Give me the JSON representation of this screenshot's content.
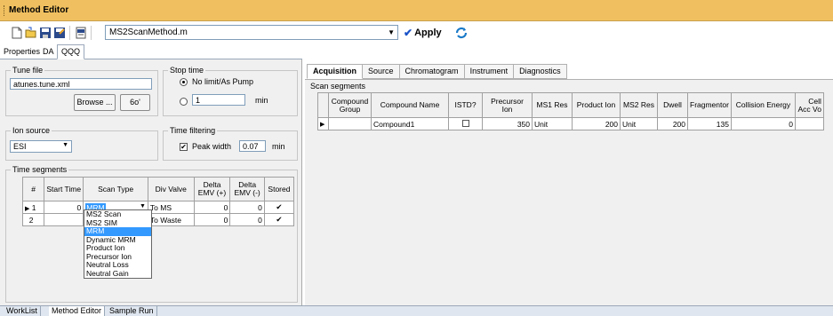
{
  "window": {
    "title": "Method Editor"
  },
  "toolbar": {
    "method_file": "MS2ScanMethod.m",
    "apply_label": "Apply",
    "icons": [
      "new-icon",
      "open-icon",
      "save-icon",
      "save-as-icon",
      "print-icon",
      "refresh-icon"
    ]
  },
  "left_tabs": [
    "Properties",
    "DA",
    "QQQ"
  ],
  "tune_file": {
    "label": "Tune file",
    "value": "atunes.tune.xml",
    "browse_label": "Browse ...",
    "glasses_label": "6o'"
  },
  "stop_time": {
    "label": "Stop time",
    "option1": "No limit/As Pump",
    "value": "1",
    "unit": "min"
  },
  "ion_source": {
    "label": "Ion source",
    "value": "ESI"
  },
  "time_filtering": {
    "label": "Time filtering",
    "checkbox_label": "Peak width",
    "value": "0.07",
    "unit": "min"
  },
  "time_segments": {
    "label": "Time segments",
    "headers": [
      "#",
      "Start Time",
      "Scan Type",
      "Div Valve",
      "Delta EMV (+)",
      "Delta EMV (-)",
      "Stored"
    ],
    "rows": [
      {
        "num": "1",
        "start": "0",
        "scan": "MRM",
        "div": "To MS",
        "emv_pos": "0",
        "emv_neg": "0",
        "stored": "✔"
      },
      {
        "num": "2",
        "start": "",
        "scan": "",
        "div": "To Waste",
        "emv_pos": "0",
        "emv_neg": "0",
        "stored": "✔"
      }
    ],
    "dropdown_options": [
      "MS2 Scan",
      "MS2 SIM",
      "MRM",
      "Dynamic MRM",
      "Product Ion",
      "Precursor Ion",
      "Neutral Loss",
      "Neutral Gain"
    ],
    "dropdown_selected": "MRM"
  },
  "right_tabs": [
    "Acquisition",
    "Source",
    "Chromatogram",
    "Instrument",
    "Diagnostics"
  ],
  "scan_segments": {
    "label": "Scan segments",
    "headers": [
      "Compound Group",
      "Compound Name",
      "ISTD?",
      "Precursor Ion",
      "MS1 Res",
      "Product Ion",
      "MS2 Res",
      "Dwell",
      "Fragmentor",
      "Collision Energy",
      "Cell Acc Vo"
    ],
    "rows": [
      {
        "group": "",
        "name": "Compound1",
        "istd": "",
        "precursor": "350",
        "ms1res": "Unit",
        "product": "200",
        "ms2res": "Unit",
        "dwell": "200",
        "fragmentor": "135",
        "ce": "0",
        "cav": ""
      }
    ]
  },
  "bottom_tabs": [
    "WorkList",
    "Method Editor",
    "Sample Run"
  ]
}
